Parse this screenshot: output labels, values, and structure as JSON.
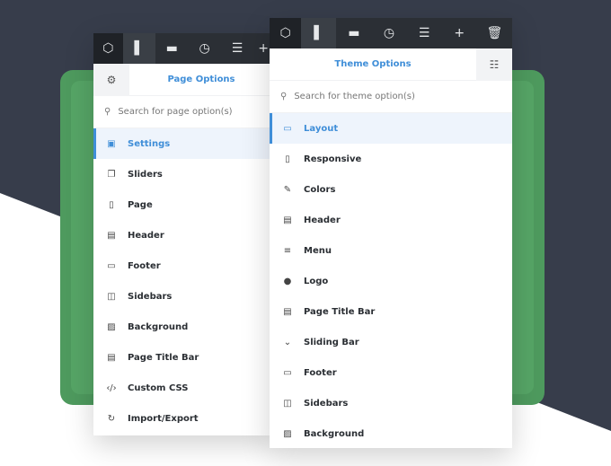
{
  "page_options": {
    "title": "Page Options",
    "search_placeholder": "Search for page option(s)",
    "items": [
      {
        "label": "Settings",
        "icon": "settings-icon",
        "active": true
      },
      {
        "label": "Sliders",
        "icon": "sliders-icon"
      },
      {
        "label": "Page",
        "icon": "page-icon"
      },
      {
        "label": "Header",
        "icon": "header-icon"
      },
      {
        "label": "Footer",
        "icon": "footer-icon"
      },
      {
        "label": "Sidebars",
        "icon": "sidebars-icon"
      },
      {
        "label": "Background",
        "icon": "background-icon"
      },
      {
        "label": "Page Title Bar",
        "icon": "page-title-bar-icon"
      },
      {
        "label": "Custom CSS",
        "icon": "code-icon"
      },
      {
        "label": "Import/Export",
        "icon": "refresh-icon"
      }
    ]
  },
  "theme_options": {
    "title": "Theme Options",
    "search_placeholder": "Search for theme option(s)",
    "items": [
      {
        "label": "Layout",
        "icon": "layout-icon",
        "active": true
      },
      {
        "label": "Responsive",
        "icon": "mobile-icon"
      },
      {
        "label": "Colors",
        "icon": "eyedropper-icon"
      },
      {
        "label": "Header",
        "icon": "header-icon"
      },
      {
        "label": "Menu",
        "icon": "menu-icon"
      },
      {
        "label": "Logo",
        "icon": "logo-icon"
      },
      {
        "label": "Page Title Bar",
        "icon": "page-title-bar-icon"
      },
      {
        "label": "Sliding Bar",
        "icon": "chevron-down-icon"
      },
      {
        "label": "Footer",
        "icon": "footer-icon"
      },
      {
        "label": "Sidebars",
        "icon": "sidebars-icon"
      },
      {
        "label": "Background",
        "icon": "background-icon"
      }
    ]
  },
  "colors": {
    "accent": "#3f8ed8",
    "toolbar": "#2b2f35",
    "green": "#4e9a5e"
  }
}
